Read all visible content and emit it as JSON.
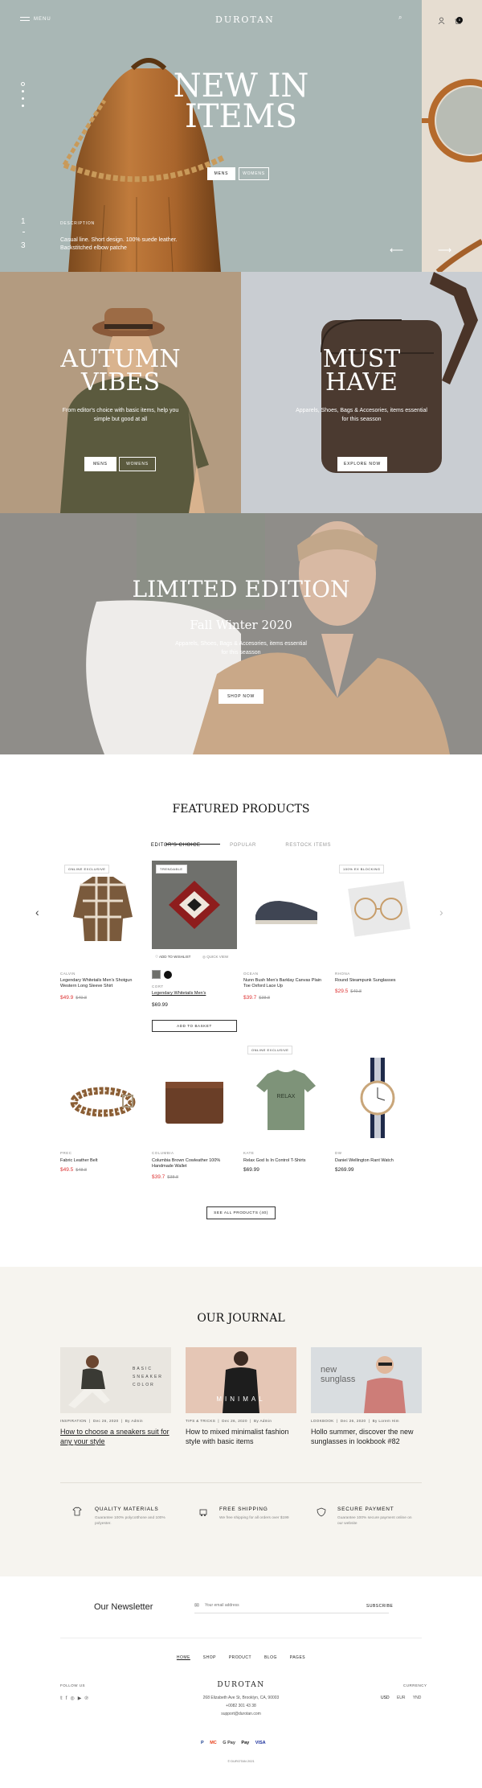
{
  "header": {
    "menu_label": "MENU",
    "logo": "DUROTAN",
    "cart_count": "0"
  },
  "hero": {
    "title_line1": "NEW IN",
    "title_line2": "ITEMS",
    "btn_mens": "MENS",
    "btn_womens": "WOMENS",
    "desc_label": "DESCRIPTION",
    "desc_text": "Casual line. Short design. 100% suede leather. Backstitched elbow patche",
    "slide_current": "1",
    "slide_total": "3"
  },
  "autumn": {
    "title_line1": "AUTUMN",
    "title_line2": "VIBES",
    "text": "From editor's choice with basic items, help you simple but good at all",
    "btn_mens": "MENS",
    "btn_womens": "WOMENS",
    "bg": "#b39b80"
  },
  "musthave": {
    "title_line1": "MUST",
    "title_line2": "HAVE",
    "text": "Apparels, Shoes, Bags & Accesories, items essential for this seasson",
    "btn": "EXPLORE NOW",
    "bg": "#c9cdd2"
  },
  "limited": {
    "title": "LIMITED EDITION",
    "subtitle": "Fall Winter 2020",
    "text": "Apparels, Shoes, Bags & Accesories, items essential for this seasson",
    "btn": "SHOP NOW"
  },
  "featured": {
    "heading": "FEATURED PRODUCTS",
    "tabs": [
      "EDITOR'S CHOICE",
      "POPULAR",
      "RESTOCK ITEMS"
    ],
    "card_actions": {
      "wishlist": "ADD TO WISHLIST",
      "quickview": "QUICK VIEW",
      "basket": "ADD TO BASKET"
    },
    "products": [
      {
        "badge": "ONLINE EXCLUSIVE",
        "brand": "CALVIN",
        "name": "Legendary Whitetails Men's Shotgun Western Long Sleeve Shirt",
        "price": "$49.9",
        "old": "$49.8",
        "sale": true
      },
      {
        "badge": "TRENDABLE",
        "brand": "CORT",
        "name": "Legendary Whitetails Men's",
        "price": "$69.99",
        "old": "",
        "sale": false
      },
      {
        "badge": "",
        "brand": "OCEAN",
        "name": "Nunn Bush Men's Barklay Canvas Plain Toe Oxford Lace Up",
        "price": "$39.7",
        "old": "$38.8",
        "sale": true
      },
      {
        "badge": "100% EX BLOCKING",
        "brand": "RHONA",
        "name": "Round Steampunk Sunglasses",
        "price": "$29.5",
        "old": "$49.8",
        "sale": true
      },
      {
        "badge": "",
        "brand": "PREC",
        "name": "Fabric Leather Belt",
        "price": "$49.5",
        "old": "$48.8",
        "sale": true
      },
      {
        "badge": "",
        "brand": "COLUMBIA",
        "name": "Columbia Brown Cowleather 100% Handmade Wallet",
        "price": "$39.7",
        "old": "$38.8",
        "sale": true
      },
      {
        "badge": "ONLINE EXCLUSIVE",
        "brand": "KATE",
        "name": "Relax God Is In Control T-Shirts",
        "price": "$69.99",
        "old": "",
        "sale": false
      },
      {
        "badge": "",
        "brand": "DW",
        "name": "Daniel Wellington Rant Watch",
        "price": "$269.99",
        "old": "",
        "sale": false
      }
    ],
    "see_all": "SEE ALL PRODUCTS (40)"
  },
  "journal": {
    "heading": "OUR JOURNAL",
    "posts": [
      {
        "cat": "INSPIRATION",
        "date": "Dec 26, 2020",
        "author": "By Admin",
        "title": "How to choose a sneakers suit for any your style",
        "img_text": "BASIC SNEAKER COLOR"
      },
      {
        "cat": "TIPS & TRICKS",
        "date": "Dec 26, 2020",
        "author": "By Admin",
        "title": "How to mixed minimalist fashion style with basic items",
        "img_text": "MINIMAL"
      },
      {
        "cat": "LOOKBOOK",
        "date": "Dec 26, 2020",
        "author": "By Lorem Him",
        "title": "Hollo summer, discover the new sunglasses in lookbook #82",
        "img_text": "new sunglass"
      }
    ]
  },
  "features": [
    {
      "title": "QUALITY MATERIALS",
      "desc": "Guarantee 100% polycotthone and 100% polyester."
    },
    {
      "title": "FREE SHIPPING",
      "desc": "We free shipping for all orders over $199"
    },
    {
      "title": "SECURE PAYMENT",
      "desc": "Guarantee 100% secure payment online on our website"
    }
  ],
  "newsletter": {
    "heading": "Our Newsletter",
    "placeholder": "Your email address",
    "btn": "SUBSCRIBE"
  },
  "footer": {
    "nav": [
      "HOME",
      "SHOP",
      "PRODUCT",
      "BLOG",
      "PAGES"
    ],
    "follow": "FOLLOW US",
    "logo": "DUROTAN",
    "address": "268 Elizabeth Ave St, Brooklyn, CA, 90003",
    "phone": "+0082 301 43 38",
    "email": "support@durotan.com",
    "currency_label": "CURRENCY",
    "currencies": [
      "USD",
      "EUR",
      "YND"
    ],
    "payments": [
      "P",
      "MC",
      "G Pay",
      "Pay",
      "VISA"
    ],
    "copyright": "© DUROTAN 2021"
  }
}
